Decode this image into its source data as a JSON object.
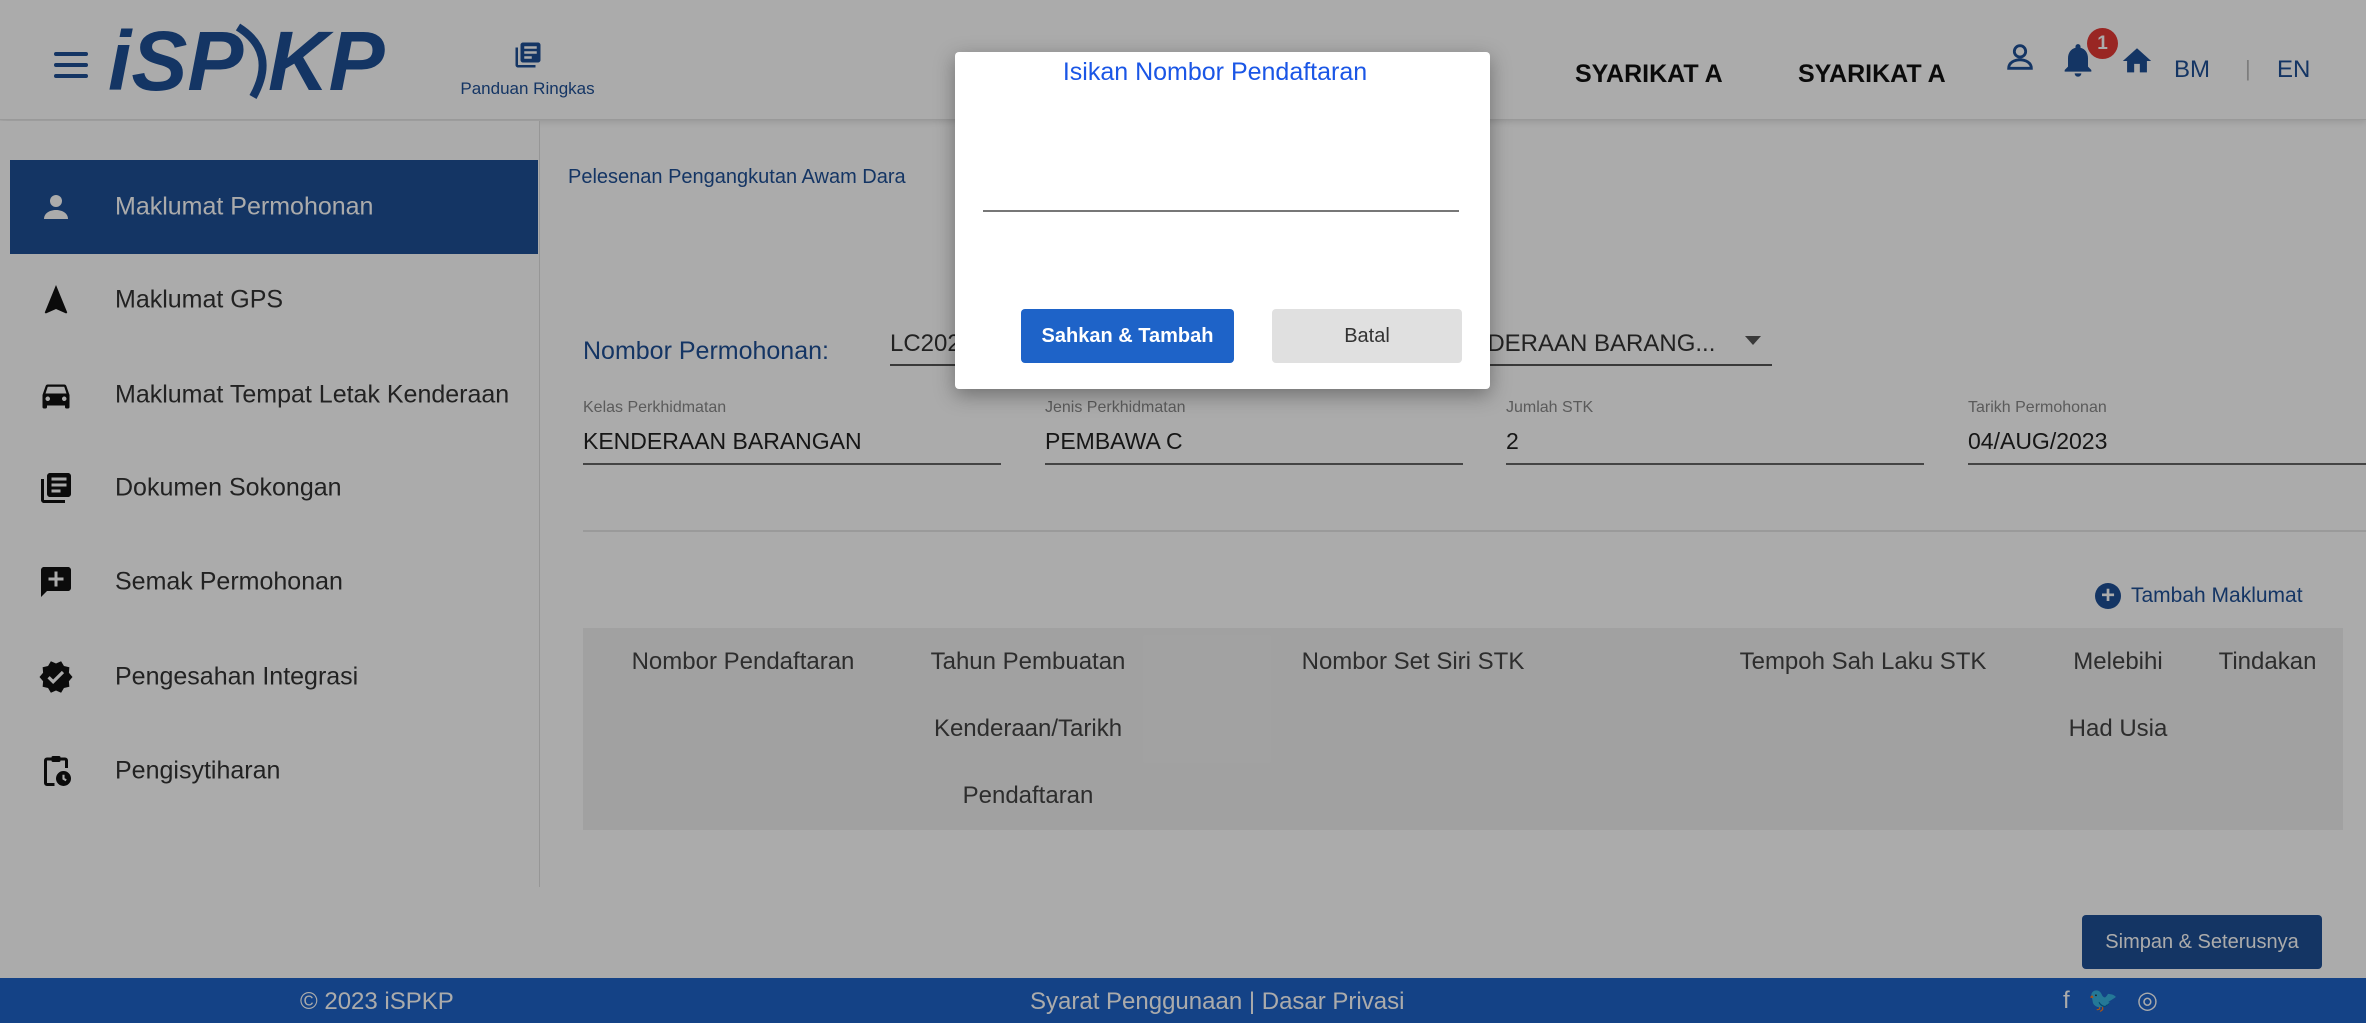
{
  "header": {
    "logo_text": "iSPKP",
    "guide_label": "Panduan Ringkas",
    "company_1": "SYARIKAT A",
    "company_2": "SYARIKAT A",
    "notification_count": "1",
    "lang_bm": "BM",
    "lang_sep": "|",
    "lang_en": "EN"
  },
  "sidebar": {
    "items": [
      {
        "label": "Maklumat Permohonan",
        "icon": "user-icon",
        "active": true
      },
      {
        "label": "Maklumat GPS",
        "icon": "navigation-arrow-icon"
      },
      {
        "label": "Maklumat Tempat Letak Kenderaan",
        "icon": "car-icon"
      },
      {
        "label": "Dokumen Sokongan",
        "icon": "documents-icon"
      },
      {
        "label": "Semak Permohonan",
        "icon": "review-icon"
      },
      {
        "label": "Pengesahan Integrasi",
        "icon": "verified-badge-icon"
      },
      {
        "label": "Pengisytiharan",
        "icon": "clipboard-clock-icon"
      }
    ]
  },
  "main": {
    "breadcrumb": "Pelesenan Pengangkutan Awam Dara",
    "application_label": "Nombor Permohonan:",
    "application_value": "LC202",
    "vehicle_select_value": "NDERAAN BARANG...",
    "fields": [
      {
        "label": "Kelas Perkhidmatan",
        "value": "KENDERAAN BARANGAN"
      },
      {
        "label": "Jenis Perkhidmatan",
        "value": "PEMBAWA C"
      },
      {
        "label": "Jumlah STK",
        "value": "2"
      },
      {
        "label": "Tarikh Permohonan",
        "value": "04/AUG/2023"
      }
    ],
    "add_info_label": "Tambah Maklumat",
    "table_headers": {
      "reg_no": "Nombor Pendaftaran",
      "year_line1": "Tahun Pembuatan",
      "year_line2": "Kenderaan/Tarikh",
      "year_line3": "Pendaftaran",
      "set_no": "Nombor Set Siri STK",
      "validity": "Tempoh Sah Laku STK",
      "over_line1": "Melebihi",
      "over_line2": "Had Usia",
      "action": "Tindakan"
    },
    "save_next_label": "Simpan & Seterusnya"
  },
  "footer": {
    "copyright": "© 2023 iSPKP",
    "links": "Syarat Penggunaan | Dasar Privasi",
    "social": "f 🐦 ◎"
  },
  "dialog": {
    "title": "Isikan Nombor Pendaftaran",
    "input_value": "",
    "confirm_label": "Sahkan & Tambah",
    "cancel_label": "Batal"
  },
  "colors": {
    "primary": "#1e4f96",
    "footer": "#1e63c8",
    "dialog_title": "#1a56e6",
    "badge": "#e53935"
  }
}
